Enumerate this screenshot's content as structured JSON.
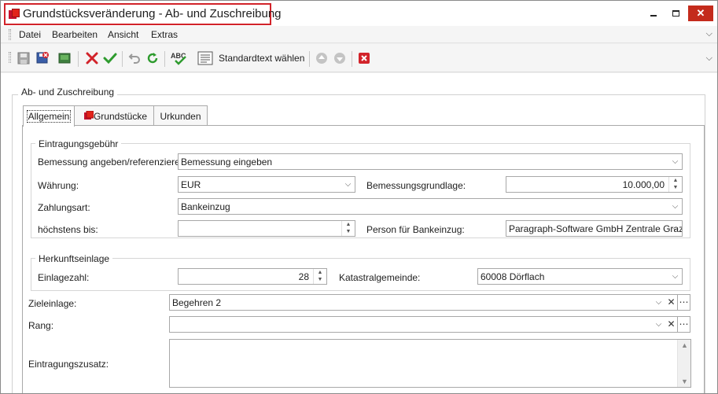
{
  "window": {
    "title": "Grundstücksveränderung - Ab- und Zuschreibung",
    "controls": {
      "minimize": "",
      "maximize": "",
      "close": "✕"
    }
  },
  "menu": {
    "items": [
      "Datei",
      "Bearbeiten",
      "Ansicht",
      "Extras"
    ]
  },
  "toolbar": {
    "standardtext_label": "Standardtext wählen",
    "icons": [
      "save-icon",
      "save-close-icon",
      "screen-icon",
      "cancel-icon",
      "confirm-icon",
      "undo-icon",
      "refresh-icon",
      "spellcheck-icon",
      "text-template-icon",
      "move-up-icon",
      "move-down-icon",
      "close-record-icon"
    ]
  },
  "form": {
    "group_caption": "Ab- und Zuschreibung",
    "tabs": [
      "Allgemein",
      "Grundstücke",
      "Urkunden"
    ],
    "eintragungsgebuehr": {
      "caption": "Eintragungsgebühr",
      "bemessung_label": "Bemessung angeben/referenzieren:",
      "bemessung_value": "Bemessung eingeben",
      "waehrung_label": "Währung:",
      "waehrung_value": "EUR",
      "grundlage_label": "Bemessungsgrundlage:",
      "grundlage_value": "10.000,00",
      "zahlungsart_label": "Zahlungsart:",
      "zahlungsart_value": "Bankeinzug",
      "hoechstens_label": "höchstens bis:",
      "hoechstens_value": "",
      "person_label": "Person für Bankeinzug:",
      "person_value": "Paragraph-Software GmbH Zentrale Graz"
    },
    "herkunftseinlage": {
      "caption": "Herkunftseinlage",
      "einlagezahl_label": "Einlagezahl:",
      "einlagezahl_value": "28",
      "katastral_label": "Katastralgemeinde:",
      "katastral_value": "60008 Dörflach"
    },
    "zieleinlage_label": "Zieleinlage:",
    "zieleinlage_value": "Begehren 2",
    "rang_label": "Rang:",
    "rang_value": "",
    "zusatz_label": "Eintragungszusatz:",
    "zusatz_value": ""
  },
  "colors": {
    "accent_red": "#d2232a",
    "confirm_green": "#2e9b2e"
  }
}
